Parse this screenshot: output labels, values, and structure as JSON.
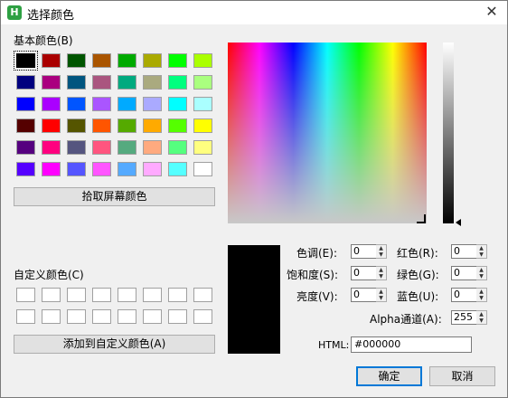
{
  "window": {
    "title": "选择颜色",
    "close_glyph": "✕",
    "icon_letter": "H"
  },
  "basic_colors": {
    "label": "基本颜色(B)",
    "swatches": [
      "#000000",
      "#aa0000",
      "#005500",
      "#aa5500",
      "#00aa00",
      "#aaaa00",
      "#00ff00",
      "#aaff00",
      "#00007f",
      "#aa007f",
      "#00557f",
      "#aa557f",
      "#00aa7f",
      "#aaaa7f",
      "#00ff7f",
      "#aaff7f",
      "#0000ff",
      "#aa00ff",
      "#0055ff",
      "#aa55ff",
      "#00aaff",
      "#aaaaff",
      "#00ffff",
      "#aaffff",
      "#550000",
      "#ff0000",
      "#555500",
      "#ff5500",
      "#55aa00",
      "#ffaa00",
      "#55ff00",
      "#ffff00",
      "#55007f",
      "#ff007f",
      "#55557f",
      "#ff557f",
      "#55aa7f",
      "#ffaa7f",
      "#55ff7f",
      "#ffff7f",
      "#5500ff",
      "#ff00ff",
      "#5555ff",
      "#ff55ff",
      "#55aaff",
      "#ffaaff",
      "#55ffff",
      "#ffffff"
    ],
    "selected_index": 0
  },
  "pick_screen_button": "拾取屏幕颜色",
  "custom_colors": {
    "label": "自定义颜色(C)",
    "count": 16
  },
  "add_custom_button": "添加到自定义颜色(A)",
  "fields": {
    "hue": {
      "label": "色调(E):",
      "value": "0"
    },
    "sat": {
      "label": "饱和度(S):",
      "value": "0"
    },
    "val": {
      "label": "亮度(V):",
      "value": "0"
    },
    "red": {
      "label": "红色(R):",
      "value": "0"
    },
    "green": {
      "label": "绿色(G):",
      "value": "0"
    },
    "blue": {
      "label": "蓝色(U):",
      "value": "0"
    },
    "alpha": {
      "label": "Alpha通道(A):",
      "value": "255"
    },
    "html": {
      "label": "HTML:",
      "value": "#000000"
    }
  },
  "current_color": "#000000",
  "ok_button": "确定",
  "cancel_button": "取消"
}
